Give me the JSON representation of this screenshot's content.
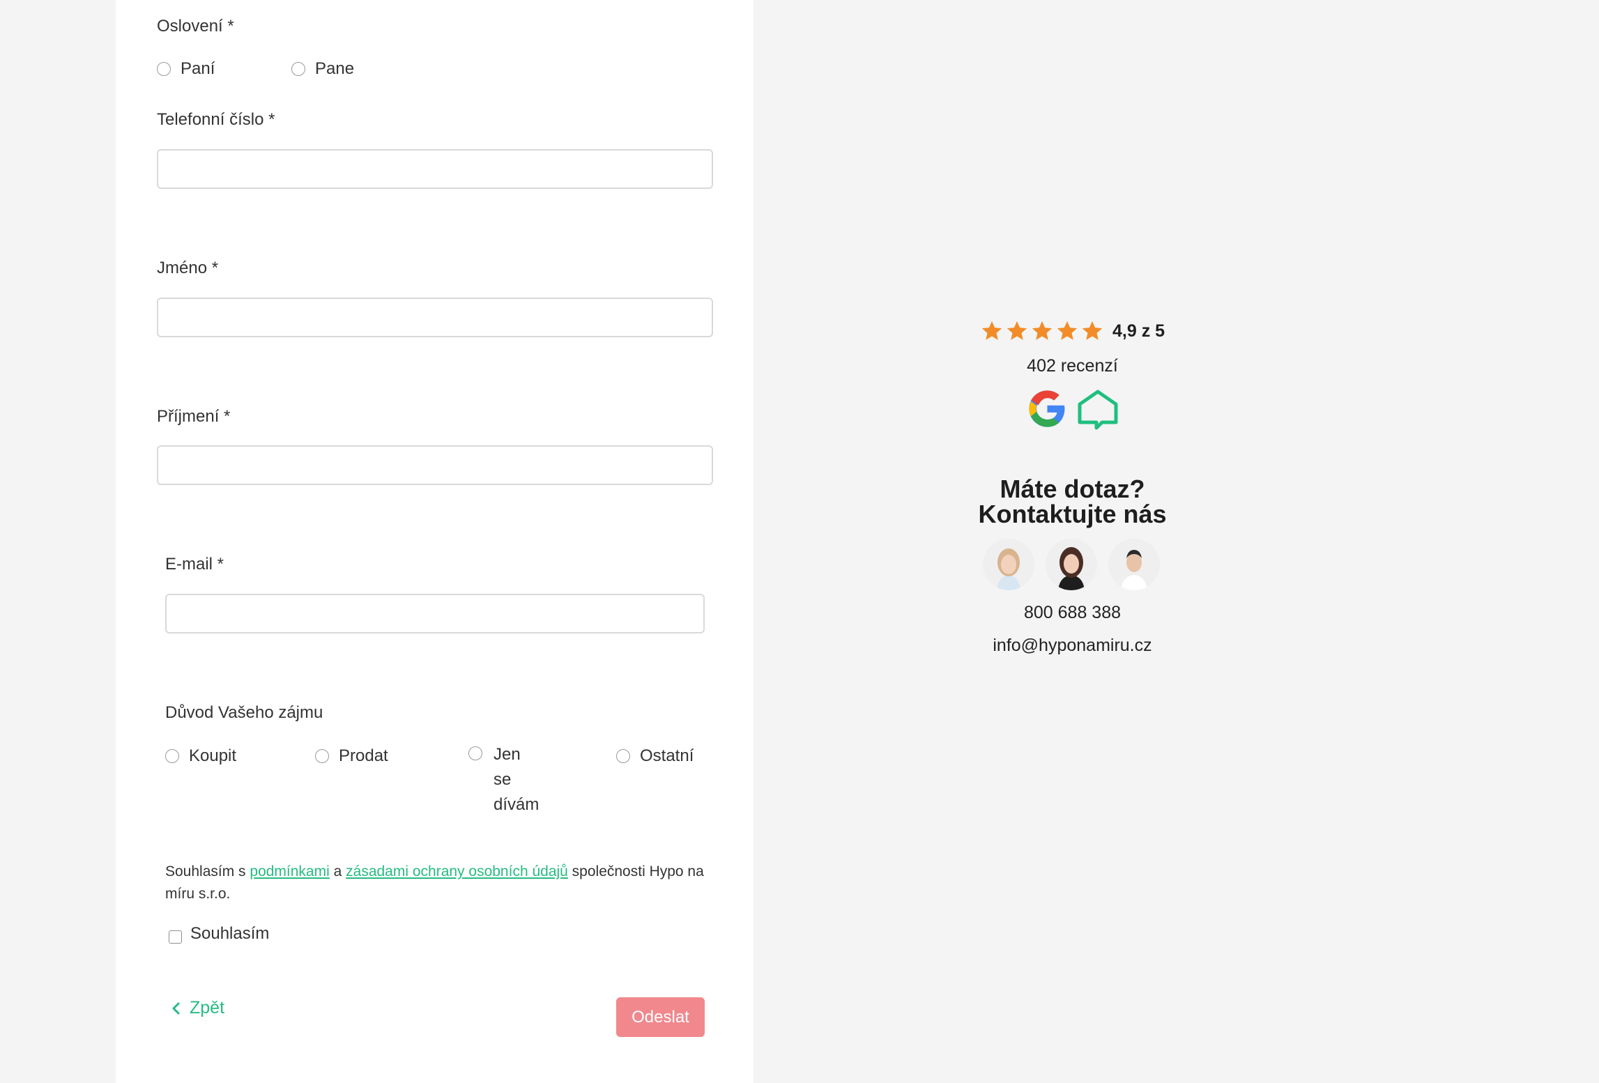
{
  "form": {
    "salutation": {
      "label": "Oslovení *",
      "options": [
        "Paní",
        "Pane"
      ]
    },
    "phone": {
      "label": "Telefonní číslo *",
      "value": ""
    },
    "first_name": {
      "label": "Jméno *",
      "value": ""
    },
    "last_name": {
      "label": "Příjmení *",
      "value": ""
    },
    "email": {
      "label": "E-mail *",
      "value": ""
    },
    "reason": {
      "label": "Důvod Vašeho zájmu",
      "options": [
        "Koupit",
        "Prodat",
        "Jen",
        "se",
        "dívám",
        "Ostatní"
      ]
    },
    "consent": {
      "prefix": "Souhlasím s ",
      "terms_link": "podmínkami",
      "middle": " a ",
      "privacy_link": "zásadami ochrany osobních údajů",
      "suffix": " společnosti Hypo na míru s.r.o.",
      "checkbox_label": "Souhlasím"
    },
    "back_label": "Zpět",
    "submit_label": "Odeslat"
  },
  "sidebar": {
    "rating": {
      "text": "4,9 z 5",
      "stars": 5
    },
    "reviews": "402 recenzí",
    "heading_line1": "Máte dotaz?",
    "heading_line2": "Kontaktujte nás",
    "phone": "800 688 388",
    "email": "info@hyponamiru.cz"
  },
  "colors": {
    "accent": "#26bb82",
    "submit_disabled": "#f0888d",
    "star": "#f28c28",
    "page_bg": "#f4f4f4"
  }
}
